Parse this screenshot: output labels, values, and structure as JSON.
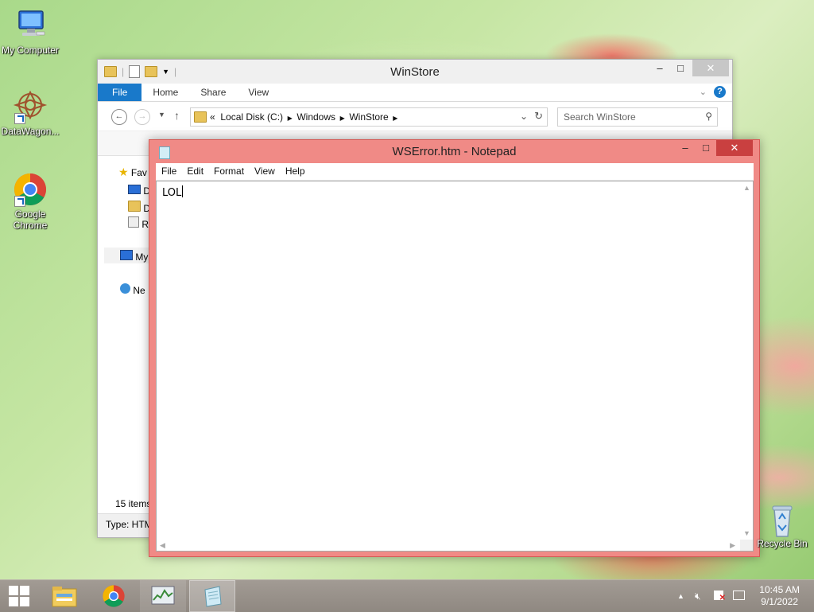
{
  "desktop": {
    "icons": [
      {
        "label": "My Computer"
      },
      {
        "label": "DataWagon..."
      },
      {
        "label": "Google Chrome"
      }
    ],
    "recycle_bin": {
      "label": "Recycle Bin"
    }
  },
  "explorer": {
    "title": "WinStore",
    "ribbon_tabs": [
      "File",
      "Home",
      "Share",
      "View"
    ],
    "address": {
      "overflow": "«",
      "crumbs": [
        "Local Disk (C:)",
        "Windows",
        "WinStore"
      ]
    },
    "search_placeholder": "Search WinStore",
    "nav_pane": [
      "Fav",
      "D",
      "D",
      "R",
      "My",
      "Ne"
    ],
    "status_items": "15 items",
    "status_type": "Type: HTM"
  },
  "notepad": {
    "title": "WSError.htm - Notepad",
    "menu": [
      "File",
      "Edit",
      "Format",
      "View",
      "Help"
    ],
    "content": "LOL"
  },
  "taskbar": {
    "clock_time": "10:45 AM",
    "clock_date": "9/1/2022"
  },
  "colors": {
    "notepad_frame": "#f08a86",
    "close_button": "#c94040",
    "ribbon_file_tab": "#1979ca",
    "taskbar": "#978f88"
  },
  "icons": [
    "windows-start-icon",
    "file-explorer-icon",
    "chrome-icon",
    "task-manager-icon",
    "notepad-icon",
    "speaker-muted-icon",
    "action-center-icon",
    "network-icon"
  ]
}
